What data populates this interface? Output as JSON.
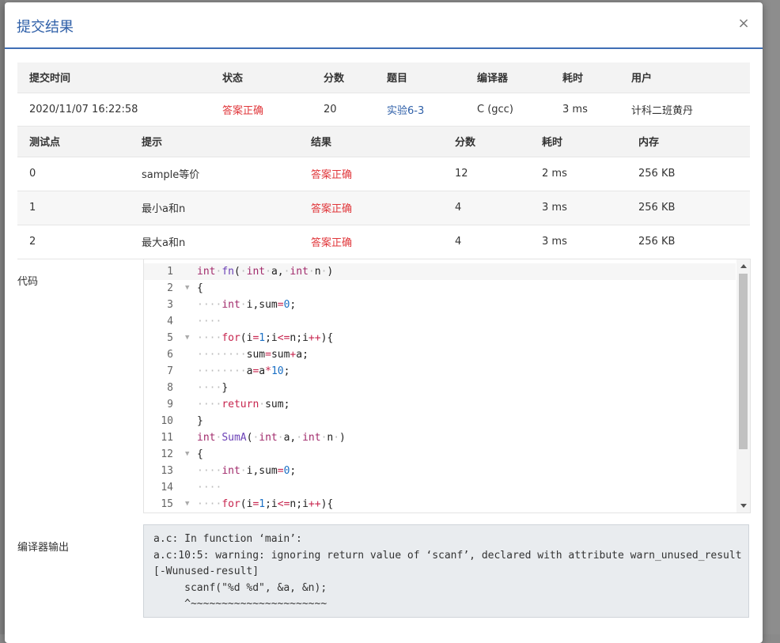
{
  "modal": {
    "title": "提交结果",
    "close": "×"
  },
  "summary": {
    "headers": [
      "提交时间",
      "状态",
      "分数",
      "题目",
      "编译器",
      "耗时",
      "用户"
    ],
    "row": [
      "2020/11/07 16:22:58",
      "答案正确",
      "20",
      "实验6-3",
      "C (gcc)",
      "3 ms",
      "计科二班黄丹"
    ]
  },
  "tests": {
    "headers": [
      "测试点",
      "提示",
      "结果",
      "分数",
      "耗时",
      "内存"
    ],
    "rows": [
      [
        "0",
        "sample等价",
        "答案正确",
        "12",
        "2 ms",
        "256 KB"
      ],
      [
        "1",
        "最小a和n",
        "答案正确",
        "4",
        "3 ms",
        "256 KB"
      ],
      [
        "2",
        "最大a和n",
        "答案正确",
        "4",
        "3 ms",
        "256 KB"
      ]
    ]
  },
  "labels": {
    "code": "代码",
    "compiler_output": "编译器输出"
  },
  "code_lines": [
    "1",
    "2",
    "3",
    "4",
    "5",
    "6",
    "7",
    "8",
    "9",
    "10",
    "11",
    "12",
    "13",
    "14",
    "15"
  ],
  "compiler_output": "a.c: In function ‘main’:\na.c:10:5: warning: ignoring return value of ‘scanf’, declared with attribute warn_unused_result\n[-Wunused-result]\n     scanf(\"%d %d\", &a, &n);\n     ^~~~~~~~~~~~~~~~~~~~~~~"
}
